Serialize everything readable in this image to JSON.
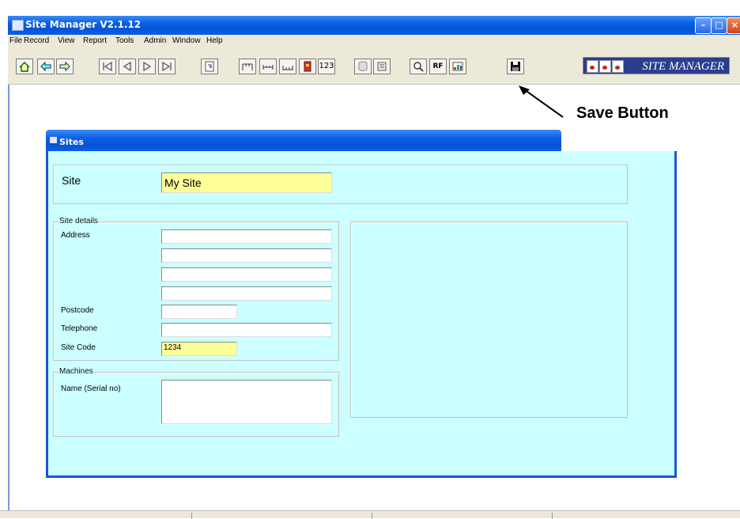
{
  "app": {
    "title": "Site Manager  V2.1.12"
  },
  "menu": [
    "File",
    "Record",
    "View",
    "Report",
    "Tools",
    "Admin",
    "Window",
    "Help"
  ],
  "toolbar": {
    "buttons": [
      "home-icon",
      "back-icon",
      "forward-icon",
      "first-record-icon",
      "previous-record-icon",
      "next-record-icon",
      "last-record-icon",
      "refresh-icon",
      "rule-icon-1",
      "rule-icon-2",
      "rule-icon-3",
      "book-icon",
      "numbers-icon",
      "database-icon",
      "notes-icon",
      "search-icon",
      "rf-icon",
      "chart-icon",
      "save-icon"
    ],
    "numbers_label": "123",
    "rf_label": "RF",
    "brand": "SITE MANAGER"
  },
  "annotation": {
    "text": "Save Button"
  },
  "sites": {
    "window_title": "Sites",
    "site_label": "Site",
    "site_value": "My Site",
    "site_details_legend": "Site details",
    "address_label": "Address",
    "postcode_label": "Postcode",
    "telephone_label": "Telephone",
    "site_code_label": "Site Code",
    "site_code_value": "1234",
    "machines_legend": "Machines",
    "machines_label": "Name (Serial no)"
  },
  "colors": {
    "form_bg": "#ccffff",
    "field_highlight": "#ffff99",
    "title_blue": "#0a5ee3"
  }
}
